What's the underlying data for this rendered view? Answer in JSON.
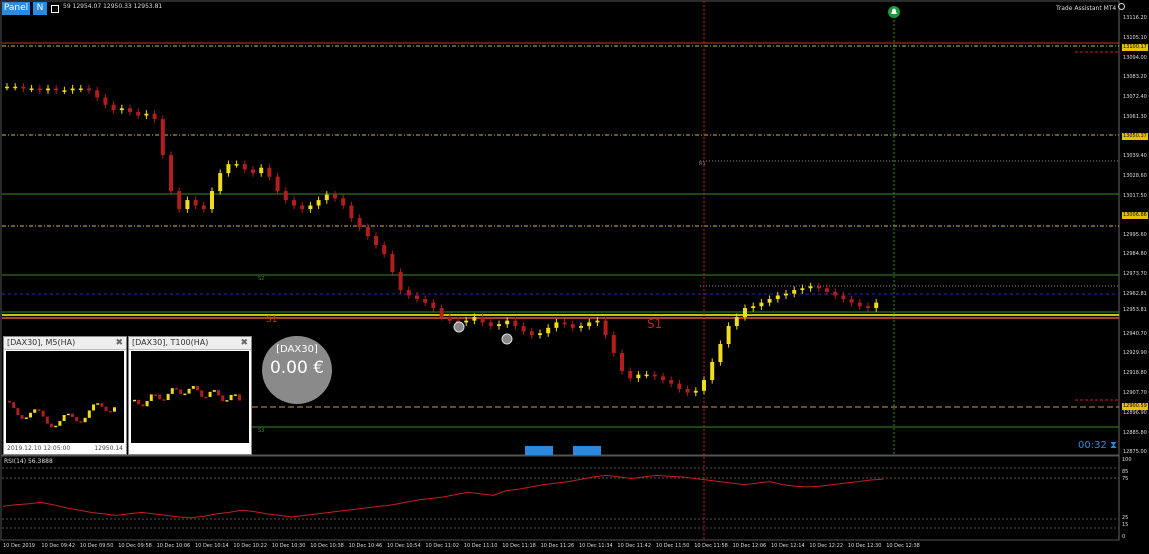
{
  "toolbar": {
    "panel_label": "Panel",
    "n_label": "N",
    "box_icon": "square-icon"
  },
  "header_ohlc": "59 12954.07 12950.33 12953.81",
  "trade_assistant": "Trade Assistant MT4",
  "mini_charts": [
    {
      "title": "[DAX30], M5(HA)",
      "date": "2019.12.10 12:05:00",
      "price": "12950.14"
    },
    {
      "title": "[DAX30], T100(HA)",
      "date": "",
      "price": ""
    }
  ],
  "profit_circle": {
    "symbol": "[DAX30]",
    "value": "0.00 €"
  },
  "timer": "00:32",
  "price_levels": [
    "13116.20",
    "13105.10",
    "13100.17",
    "13094.00",
    "13083.20",
    "13072.40",
    "13061.30",
    "13050.37",
    "13039.40",
    "13028.60",
    "13017.50",
    "13006.86",
    "12995.60",
    "12984.80",
    "12973.70",
    "12962.81",
    "12953.81",
    "12940.70",
    "12929.90",
    "12918.80",
    "12907.70",
    "12900.59",
    "12896.90",
    "12885.80",
    "12875.00"
  ],
  "highlighted_prices": [
    "13100.17",
    "13050.37",
    "13006.86",
    "12900.59"
  ],
  "pivot_labels": [
    "S1",
    "S1",
    "S2",
    "S3",
    "R1"
  ],
  "rsi": {
    "label": "RSI(14) 56.3888",
    "levels": [
      "100",
      "85",
      "75",
      "25",
      "15",
      "0"
    ]
  },
  "time_labels": [
    "10 Dec 2019",
    "10 Dec 09:42",
    "10 Dec 09:50",
    "10 Dec 09:58",
    "10 Dec 10:06",
    "10 Dec 10:14",
    "10 Dec 10:22",
    "10 Dec 10:30",
    "10 Dec 10:38",
    "10 Dec 10:46",
    "10 Dec 10:54",
    "10 Dec 11:02",
    "10 Dec 11:10",
    "10 Dec 11:18",
    "10 Dec 11:26",
    "10 Dec 11:34",
    "10 Dec 11:42",
    "10 Dec 11:50",
    "10 Dec 11:58",
    "10 Dec 12:06",
    "10 Dec 12:14",
    "10 Dec 12:22",
    "10 Dec 12:30",
    "10 Dec 12:38"
  ],
  "colors": {
    "bull": "#f0dc1e",
    "bear": "#b01e1e",
    "grid": "#2a2a2a",
    "support": "#3c8c28",
    "resistance": "#c85028",
    "accent": "#1e90ff",
    "rsi": "#c81e1e"
  },
  "chart_data": {
    "type": "candlestick",
    "title": "",
    "ylim": [
      12875.0,
      13116.2
    ],
    "closes": [
      13078,
      13078,
      13077,
      13077,
      13076,
      13077,
      13076,
      13076,
      13077,
      13077,
      13076,
      13072,
      13068,
      13065,
      13066,
      13064,
      13062,
      13063,
      13060,
      13040,
      13020,
      13010,
      13015,
      13012,
      13010,
      13020,
      13030,
      13035,
      13035,
      13032,
      13030,
      13033,
      13028,
      13020,
      13015,
      13012,
      13010,
      13012,
      13015,
      13018,
      13016,
      13012,
      13005,
      13000,
      12995,
      12990,
      12985,
      12975,
      12965,
      12962,
      12960,
      12958,
      12955,
      12950,
      12948,
      12947,
      12948,
      12950,
      12947,
      12945,
      12946,
      12948,
      12945,
      12942,
      12940,
      12941,
      12944,
      12947,
      12946,
      12944,
      12945,
      12947,
      12948,
      12940,
      12930,
      12920,
      12916,
      12918,
      12918,
      12917,
      12915,
      12913,
      12910,
      12908,
      12909,
      12915,
      12925,
      12935,
      12945,
      12950,
      12955,
      12956,
      12958,
      12960,
      12962,
      12963,
      12965,
      12966,
      12967,
      12966,
      12964,
      12962,
      12960,
      12958,
      12956,
      12955,
      12958
    ],
    "rsi_values": [
      40,
      42,
      43,
      45,
      42,
      38,
      35,
      32,
      30,
      28,
      30,
      32,
      30,
      28,
      26,
      25,
      27,
      30,
      32,
      35,
      33,
      30,
      28,
      26,
      28,
      30,
      32,
      34,
      36,
      38,
      40,
      42,
      45,
      48,
      50,
      52,
      55,
      58,
      56,
      54,
      60,
      62,
      65,
      68,
      70,
      72,
      75,
      78,
      80,
      78,
      76,
      78,
      80,
      79,
      78,
      76,
      74,
      72,
      70,
      68,
      70,
      72,
      68,
      66,
      65,
      66,
      68,
      70,
      72,
      74,
      75
    ]
  }
}
